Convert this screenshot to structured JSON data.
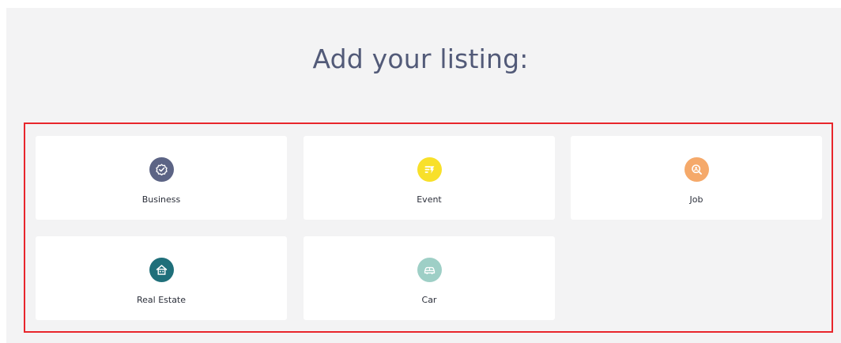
{
  "heading": "Add your listing:",
  "cards": [
    {
      "label": "Business",
      "icon": "verified-badge-icon",
      "color": "#5c6485"
    },
    {
      "label": "Event",
      "icon": "ticket-icon",
      "color": "#f8e02a"
    },
    {
      "label": "Job",
      "icon": "magnifier-person-icon",
      "color": "#f5a96a"
    },
    {
      "label": "Real Estate",
      "icon": "house-icon",
      "color": "#1f6f7a"
    },
    {
      "label": "Car",
      "icon": "car-icon",
      "color": "#9ecfc6"
    }
  ]
}
